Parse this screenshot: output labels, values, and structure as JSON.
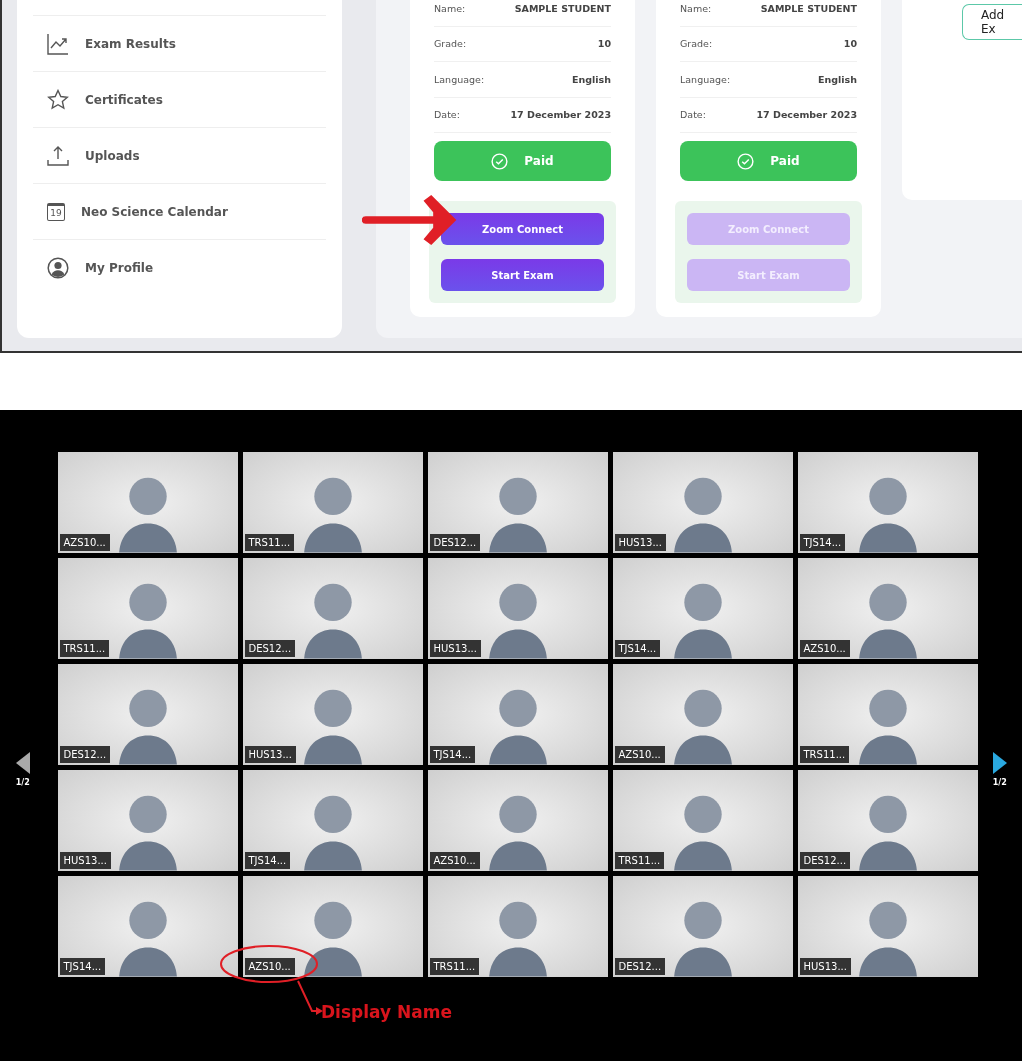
{
  "sidebar": {
    "items": [
      {
        "kind": "chart",
        "label": "Exam Results"
      },
      {
        "kind": "star",
        "label": "Certificates"
      },
      {
        "kind": "upload",
        "label": "Uploads"
      },
      {
        "kind": "calendar",
        "label": "Neo Science Calendar",
        "icon_text": "19"
      },
      {
        "kind": "profile",
        "label": "My Profile"
      }
    ]
  },
  "exam_cards": [
    {
      "fields": [
        {
          "label": "Name:",
          "value": "SAMPLE STUDENT"
        },
        {
          "label": "Grade:",
          "value": "10"
        },
        {
          "label": "Language:",
          "value": "English"
        },
        {
          "label": "Date:",
          "value": "17 December 2023"
        }
      ],
      "payment": "Paid",
      "buttons": [
        "Zoom Connect",
        "Start Exam"
      ],
      "disabled": false
    },
    {
      "fields": [
        {
          "label": "Name:",
          "value": "SAMPLE STUDENT"
        },
        {
          "label": "Grade:",
          "value": "10"
        },
        {
          "label": "Language:",
          "value": "English"
        },
        {
          "label": "Date:",
          "value": "17 December 2023"
        }
      ],
      "payment": "Paid",
      "buttons": [
        "Zoom Connect",
        "Start Exam"
      ],
      "disabled": true
    }
  ],
  "add_exam_button": "Add Ex",
  "gallery": {
    "page_indicator_left": "1/2",
    "page_indicator_right": "1/2",
    "tiles": [
      {
        "display_name": "AZS10..."
      },
      {
        "display_name": "TRS11..."
      },
      {
        "display_name": "DES12..."
      },
      {
        "display_name": "HUS13..."
      },
      {
        "display_name": "TJS14..."
      },
      {
        "display_name": "TRS11..."
      },
      {
        "display_name": "DES12..."
      },
      {
        "display_name": "HUS13..."
      },
      {
        "display_name": "TJS14..."
      },
      {
        "display_name": "AZS10..."
      },
      {
        "display_name": "DES12..."
      },
      {
        "display_name": "HUS13..."
      },
      {
        "display_name": "TJS14..."
      },
      {
        "display_name": "AZS10..."
      },
      {
        "display_name": "TRS11..."
      },
      {
        "display_name": "HUS13..."
      },
      {
        "display_name": "TJS14..."
      },
      {
        "display_name": "AZS10..."
      },
      {
        "display_name": "TRS11..."
      },
      {
        "display_name": "DES12..."
      },
      {
        "display_name": "TJS14..."
      },
      {
        "display_name": "AZS10..."
      },
      {
        "display_name": "TRS11..."
      },
      {
        "display_name": "DES12..."
      },
      {
        "display_name": "HUS13..."
      }
    ]
  },
  "annotation": {
    "label": "Display Name"
  }
}
